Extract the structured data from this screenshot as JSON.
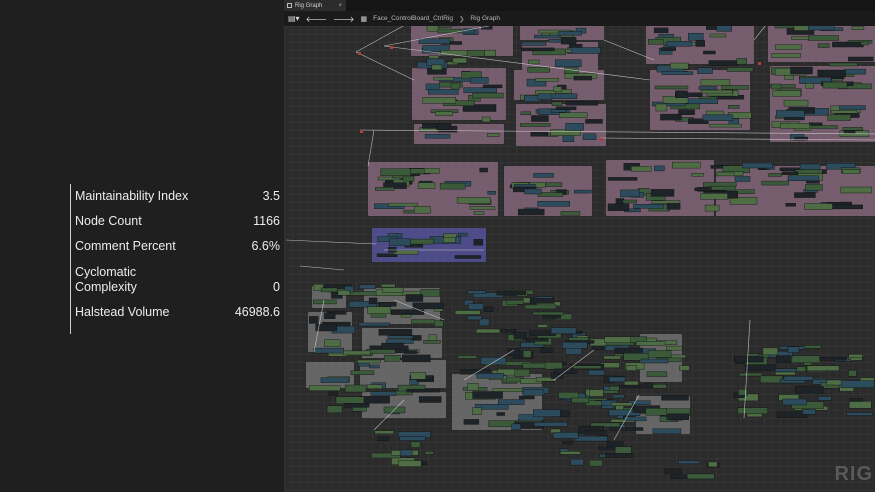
{
  "metrics": [
    {
      "label": "Maintainability Index",
      "value": "3.5"
    },
    {
      "label": "Node Count",
      "value": "1166"
    },
    {
      "label": "Comment Percent",
      "value": "6.6%"
    },
    {
      "label": "Cyclomatic Complexity",
      "value": "0"
    },
    {
      "label": "Halstead Volume",
      "value": "46988.6"
    }
  ],
  "editor": {
    "tab_title": "Rig Graph",
    "tab_close": "×",
    "breadcrumb": [
      "Face_ControlBoard_CtrlRig",
      "Rig Graph"
    ],
    "watermark": "RIG"
  },
  "colors": {
    "comment_pink": "#8f6f86",
    "comment_gray": "#7a7a7a",
    "comment_blue": "#5a58a8",
    "node_green": "#4f6d45",
    "node_teal": "#2c4b5c",
    "node_dark": "#1e2328",
    "wire": "#d8d8d8"
  }
}
